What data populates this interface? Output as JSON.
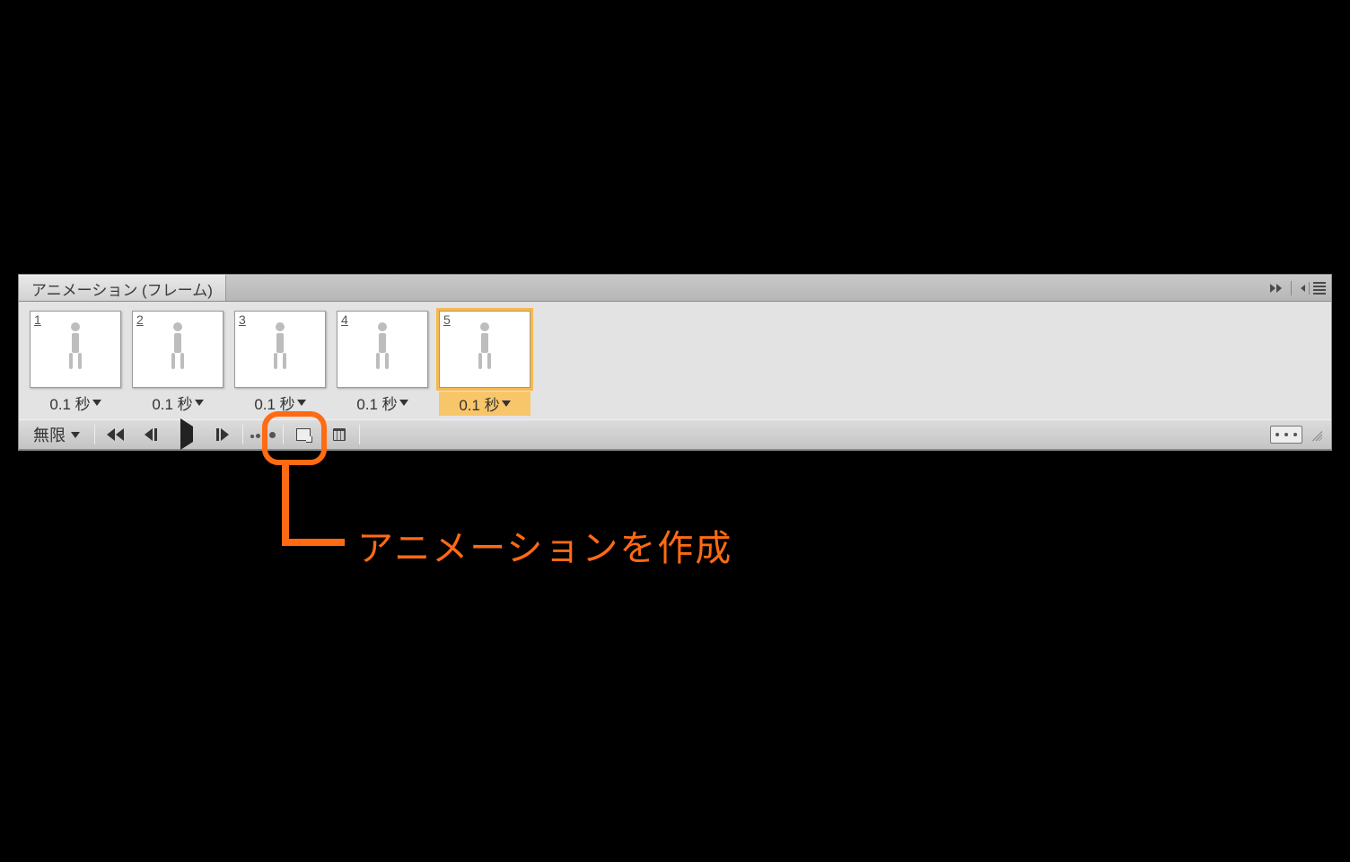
{
  "panel": {
    "tab_label": "アニメーション (フレーム)",
    "loop_label": "無限",
    "frames": [
      {
        "num": "1",
        "delay": "0.1 秒",
        "selected": false
      },
      {
        "num": "2",
        "delay": "0.1 秒",
        "selected": false
      },
      {
        "num": "3",
        "delay": "0.1 秒",
        "selected": false
      },
      {
        "num": "4",
        "delay": "0.1 秒",
        "selected": false
      },
      {
        "num": "5",
        "delay": "0.1 秒",
        "selected": true
      }
    ],
    "icons": {
      "collapse": "collapse-icon",
      "menu": "panel-menu-icon",
      "first": "go-to-first-frame-icon",
      "prev": "previous-frame-icon",
      "play": "play-icon",
      "next": "next-frame-icon",
      "tween": "tween-icon",
      "new_frame": "new-frame-icon",
      "trash": "delete-frame-icon",
      "mode": "timeline-mode-toggle-icon",
      "grip": "resize-grip-icon"
    }
  },
  "annotation": {
    "label": "アニメーションを作成"
  },
  "colors": {
    "accent": "#ff6a13",
    "panel_bg": "#d8d8d8",
    "selected_frame": "#f7b84b"
  }
}
